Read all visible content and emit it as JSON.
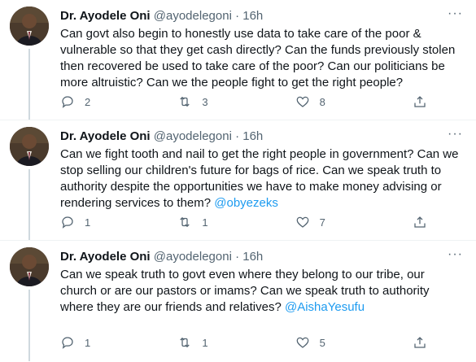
{
  "tweets": [
    {
      "name": "Dr. Ayodele Oni",
      "handle": "@ayodelegoni",
      "separator": "·",
      "time": "16h",
      "text": "Can govt also begin to honestly use data to take care of the poor & vulnerable so that they get cash directly? Can the funds previously stolen then recovered be used to take care of the poor? Can our politicians be more altruistic? Can we the people fight to get the right people?",
      "mention": "",
      "replies": "2",
      "retweets": "3",
      "likes": "8"
    },
    {
      "name": "Dr. Ayodele Oni",
      "handle": "@ayodelegoni",
      "separator": "·",
      "time": "16h",
      "text": "Can we fight tooth and nail to get the right people in government? Can we stop selling our children's future for bags of rice. Can we speak truth to authority despite the opportunities we have to make money advising or rendering services to them? ",
      "mention": "@obyezeks",
      "replies": "1",
      "retweets": "1",
      "likes": "7"
    },
    {
      "name": "Dr. Ayodele Oni",
      "handle": "@ayodelegoni",
      "separator": "·",
      "time": "16h",
      "text": "Can we speak truth to govt even where they belong to our tribe, our church or are our pastors or imams? Can we speak truth to authority where they are our friends and relatives? ",
      "mention": "@AishaYesufu",
      "replies": "1",
      "retweets": "1",
      "likes": "5"
    }
  ],
  "icons": {
    "more": "more-icon",
    "reply": "reply-icon",
    "retweet": "retweet-icon",
    "like": "heart-icon",
    "share": "share-icon"
  },
  "colors": {
    "mention": "#1d9bf0",
    "secondary_text": "#536471",
    "thread_line": "#cfd9de"
  }
}
